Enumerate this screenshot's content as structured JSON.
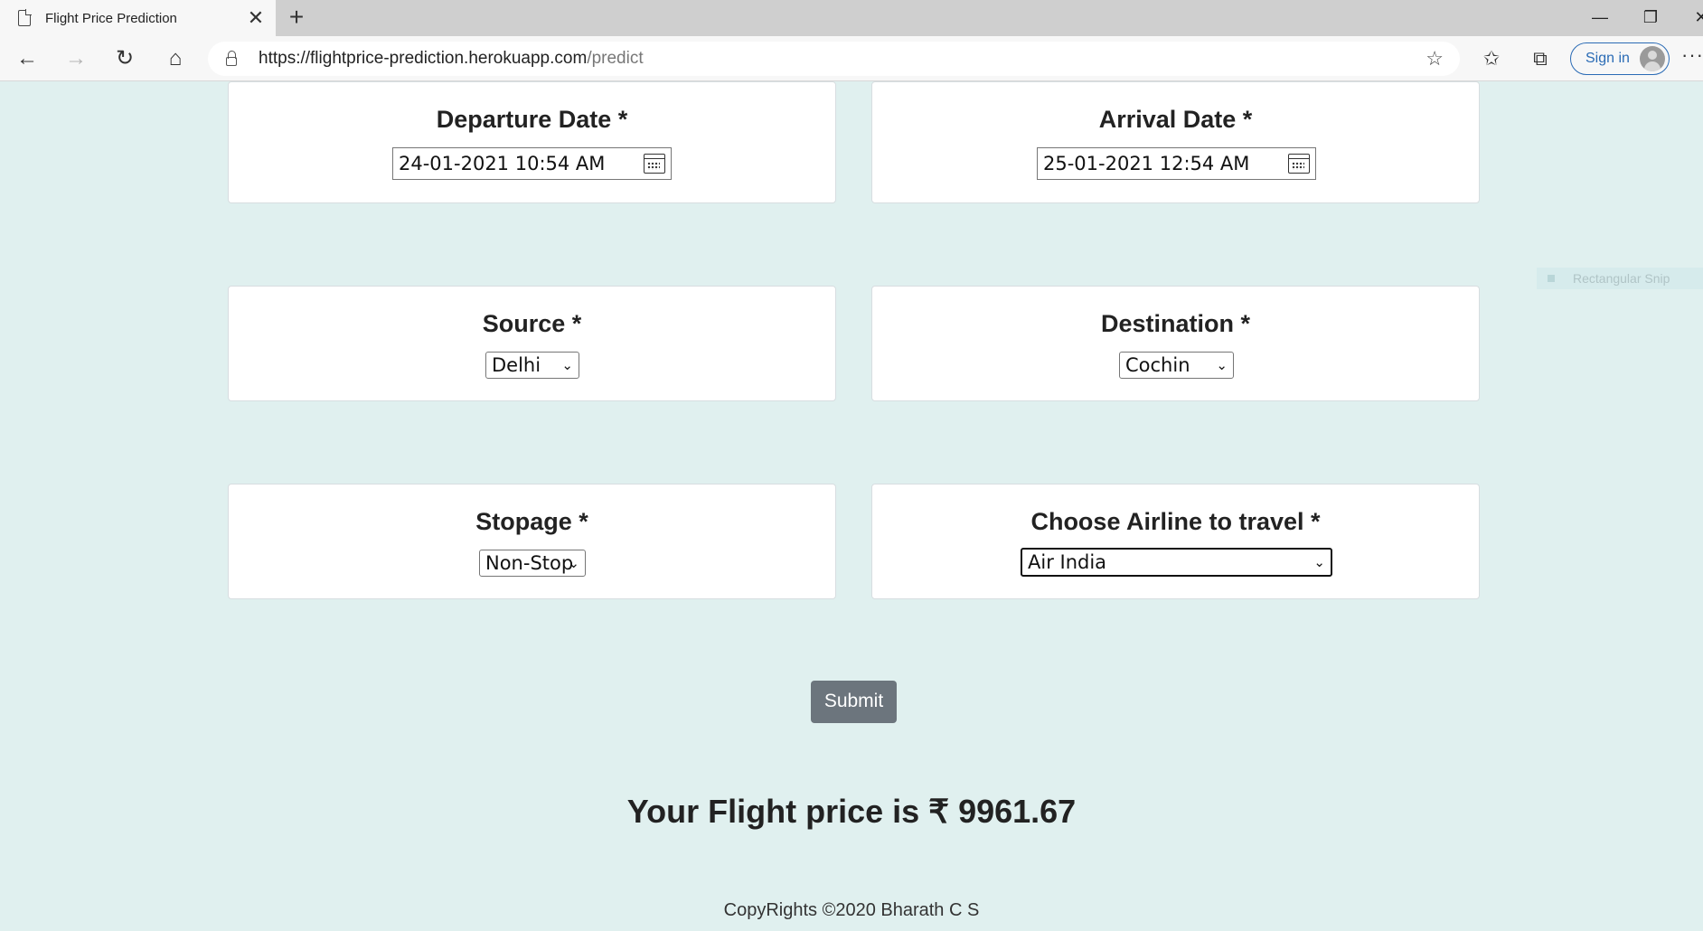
{
  "browser": {
    "tab_title": "Flight Price Prediction",
    "tab_close": "✕",
    "new_tab": "+",
    "url_host": "https://flightprice-prediction.herokuapp.com",
    "url_path": "/predict",
    "sign_in": "Sign in",
    "more": "···"
  },
  "form": {
    "departure_label": "Departure Date *",
    "departure_value": "24-01-2021 10:54 AM",
    "arrival_label": "Arrival Date *",
    "arrival_value": "25-01-2021 12:54 AM",
    "source_label": "Source *",
    "source_value": "Delhi",
    "destination_label": "Destination *",
    "destination_value": "Cochin",
    "stopage_label": "Stopage *",
    "stopage_value": "Non-Stop",
    "airline_label": "Choose Airline to travel *",
    "airline_value": "Air India",
    "submit_label": "Submit"
  },
  "result_text": "Your Flight price is ₹ 9961.67",
  "footer_text": "CopyRights ©2020 Bharath C S",
  "overlay": {
    "snip_label": "Rectangular Snip"
  }
}
